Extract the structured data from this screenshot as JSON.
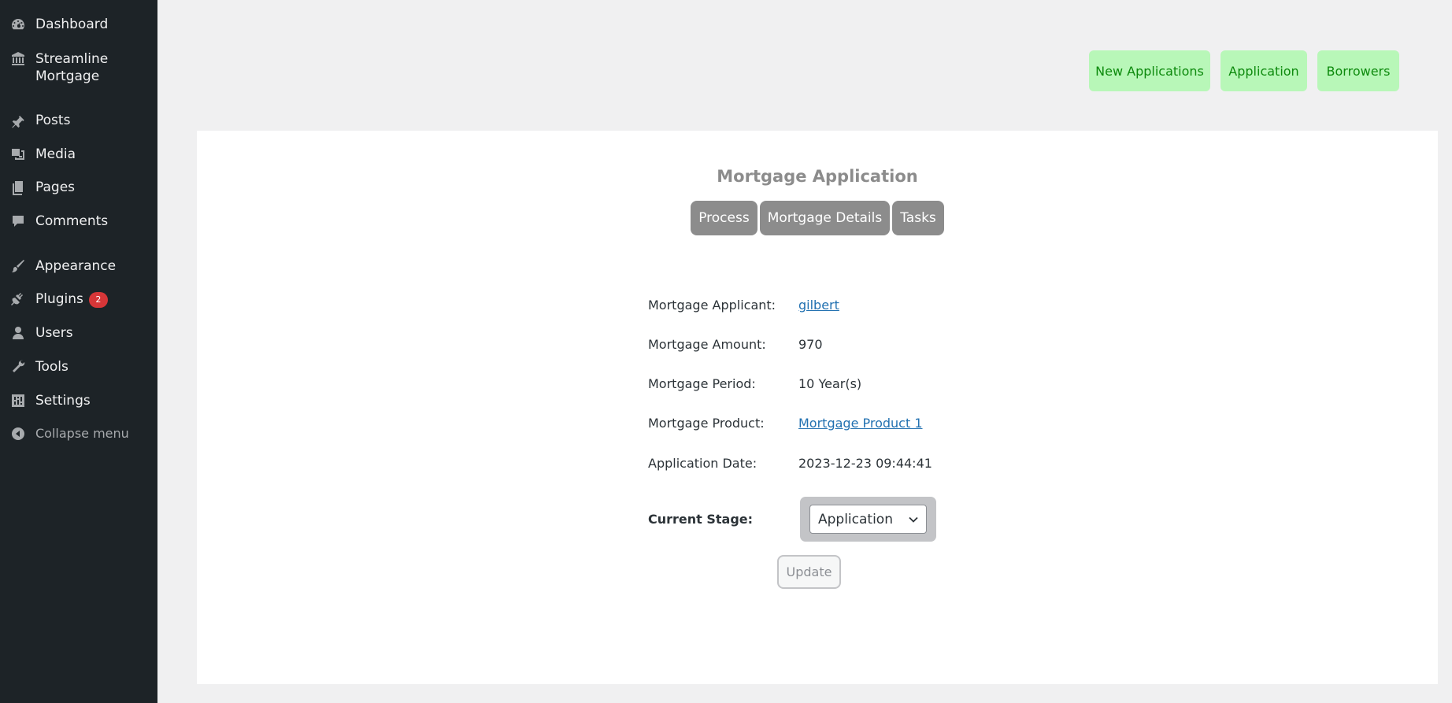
{
  "sidebar": {
    "items": [
      {
        "label": "Dashboard",
        "icon": "dashboard-icon"
      },
      {
        "label": "Streamline Mortgage",
        "icon": "bank-icon"
      },
      {
        "label": "Posts",
        "icon": "pin-icon"
      },
      {
        "label": "Media",
        "icon": "media-icon"
      },
      {
        "label": "Pages",
        "icon": "pages-icon"
      },
      {
        "label": "Comments",
        "icon": "comment-icon"
      },
      {
        "label": "Appearance",
        "icon": "brush-icon"
      },
      {
        "label": "Plugins",
        "icon": "plugin-icon",
        "badge": "2"
      },
      {
        "label": "Users",
        "icon": "user-icon"
      },
      {
        "label": "Tools",
        "icon": "wrench-icon"
      },
      {
        "label": "Settings",
        "icon": "settings-icon"
      }
    ],
    "collapse_label": "Collapse menu"
  },
  "top_nav": {
    "new_applications": "New Applications",
    "application": "Application",
    "borrowers": "Borrowers"
  },
  "card": {
    "title": "Mortgage Application",
    "tabs": [
      "Process",
      "Mortgage Details",
      "Tasks"
    ],
    "details": {
      "applicant_label": "Mortgage Applicant:",
      "applicant_value": "gilbert",
      "amount_label": "Mortgage Amount:",
      "amount_value": "970",
      "period_label": "Mortgage Period:",
      "period_value": "10 Year(s)",
      "product_label": "Mortgage Product:",
      "product_value": "Mortgage Product 1",
      "date_label": "Application Date:",
      "date_value": "2023-12-23 09:44:41"
    },
    "stage_label": "Current Stage:",
    "stage_selected": "Application",
    "update_label": "Update"
  },
  "colors": {
    "sidebar_bg": "#1d2327",
    "nav_button_bg": "#b8f7b8",
    "nav_button_text": "#0d8a0d",
    "tab_bg": "#8c8c8c",
    "link": "#2271b1",
    "badge": "#d63638"
  }
}
